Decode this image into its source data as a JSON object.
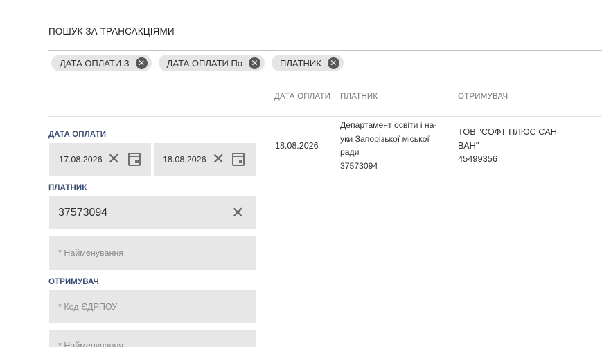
{
  "page_title": "ПОШУК ЗА ТРАНСАКЦІЯМИ",
  "active_filters": [
    {
      "label": "ДАТА ОПЛАТИ З"
    },
    {
      "label": "ДАТА ОПЛАТИ По"
    },
    {
      "label": "ПЛАТНИК"
    }
  ],
  "table": {
    "columns": [
      "ДАТА ОПЛАТИ",
      "ПЛАТНИК",
      "ОТРИМУВАЧ"
    ],
    "rows": [
      {
        "date": "18.08.2026",
        "payer_name_lines": [
          "Департамент освіти і на-",
          "уки Запорізької міської",
          "ради"
        ],
        "payer_code": "37573094",
        "recipient_name_lines": [
          "ТОВ \"СОФТ ПЛЮС САН",
          "ВАН\""
        ],
        "recipient_code": "45499356"
      }
    ]
  },
  "filters_panel": {
    "payment_date": {
      "label": "ДАТА ОПЛАТИ",
      "from_value": "17.08.2026",
      "to_value": "18.08.2026"
    },
    "payer": {
      "label": "ПЛАТНИК",
      "code_value": "37573094",
      "name_placeholder": "* Найменування"
    },
    "recipient": {
      "label": "ОТРИМУВАЧ",
      "code_placeholder": "* Код ЄДРПОУ",
      "name_placeholder": "* Найменування"
    }
  },
  "icons": {
    "chip_remove": "close-circle-icon",
    "clear": "close-icon",
    "calendar": "calendar-icon"
  }
}
